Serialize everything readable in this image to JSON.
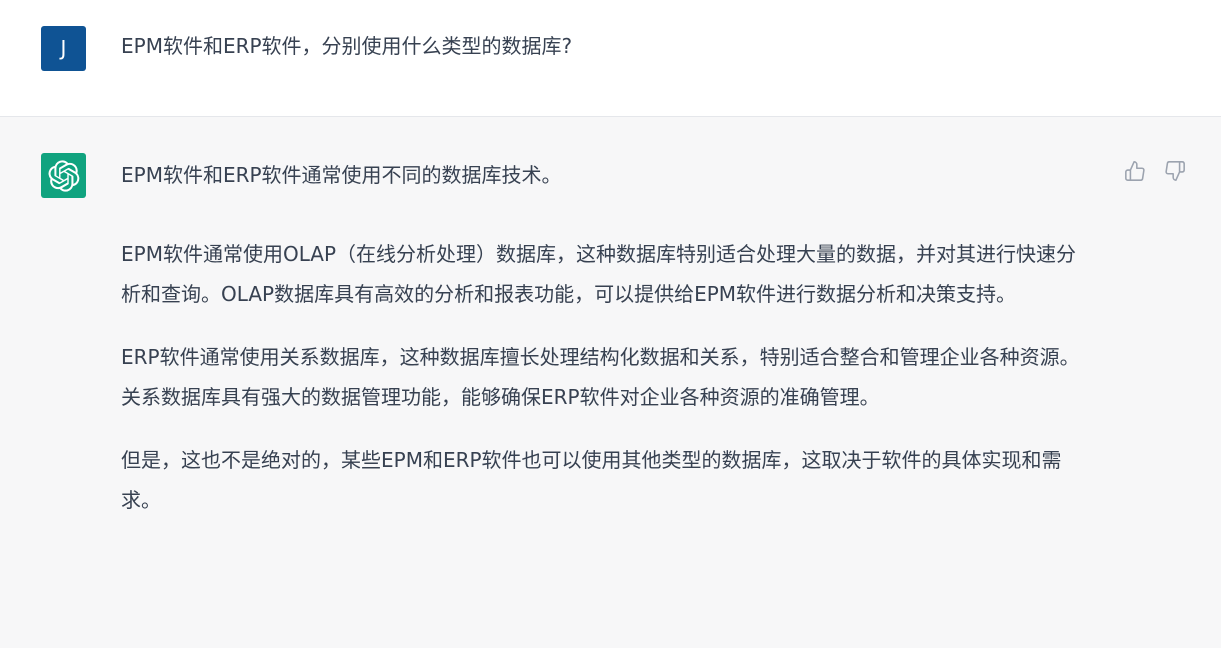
{
  "user_message": {
    "avatar_letter": "J",
    "text": "EPM软件和ERP软件，分别使用什么类型的数据库?"
  },
  "assistant_message": {
    "paragraphs": [
      "EPM软件和ERP软件通常使用不同的数据库技术。",
      "EPM软件通常使用OLAP（在线分析处理）数据库，这种数据库特别适合处理大量的数据，并对其进行快速分析和查询。OLAP数据库具有高效的分析和报表功能，可以提供给EPM软件进行数据分析和决策支持。",
      "ERP软件通常使用关系数据库，这种数据库擅长处理结构化数据和关系，特别适合整合和管理企业各种资源。关系数据库具有强大的数据管理功能，能够确保ERP软件对企业各种资源的准确管理。",
      "但是，这也不是绝对的，某些EPM和ERP软件也可以使用其他类型的数据库，这取决于软件的具体实现和需求。"
    ]
  },
  "icons": {
    "assistant_logo": "openai-logo-icon",
    "like": "thumbs-up-icon",
    "dislike": "thumbs-down-icon"
  },
  "colors": {
    "user_avatar_bg": "#0f5394",
    "assistant_avatar_bg": "#10a37f",
    "assistant_bg": "#f7f7f8",
    "text": "#374151",
    "icon": "#9ca3af"
  }
}
